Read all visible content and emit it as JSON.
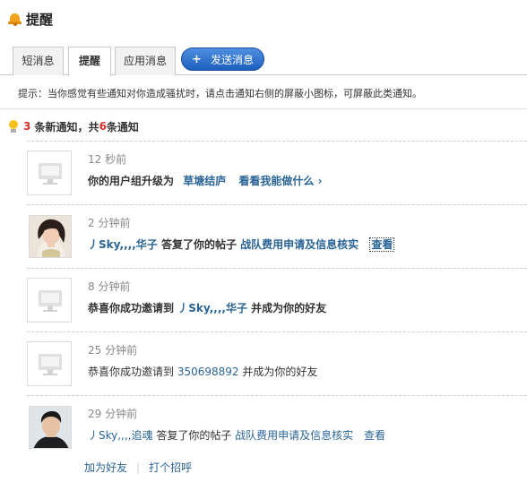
{
  "header": {
    "title": "提醒"
  },
  "tabs": {
    "messages": "短消息",
    "reminders": "提醒",
    "app_messages": "应用消息",
    "send_button": "发送消息"
  },
  "hint": "提示：当你感觉有些通知对你造成骚扰时，请点击通知右侧的屏蔽小图标，可屏蔽此类通知。",
  "summary": {
    "new_count": "3",
    "new_text": "条新通知，共",
    "total": "6",
    "total_text": "条通知"
  },
  "items": [
    {
      "time": "12 秒前",
      "text": "你的用户组升级为",
      "link1": "草塘结庐",
      "link2": "看看我能做什么 ›"
    },
    {
      "time": "2 分钟前",
      "user": "丿Sky,,,,华子",
      "text": "答复了你的帖子",
      "thread": "战队费用申请及信息核实",
      "view": "查看"
    },
    {
      "time": "8 分钟前",
      "text": "恭喜你成功邀请到",
      "user": "丿Sky,,,,华子",
      "text2": "并成为你的好友"
    },
    {
      "time": "25 分钟前",
      "text": "恭喜你成功邀请到",
      "user": "350698892",
      "text2": "并成为你的好友"
    },
    {
      "time": "29 分钟前",
      "user": "丿Sky,,,,追魂",
      "text": "答复了你的帖子",
      "thread": "战队费用申请及信息核实",
      "view": "查看"
    }
  ],
  "footer": {
    "add_friend": "加为好友",
    "greet": "打个招呼"
  },
  "colors": {
    "accent_red": "#d8312d",
    "link": "#2a6496",
    "button": "#1d5fbf"
  }
}
